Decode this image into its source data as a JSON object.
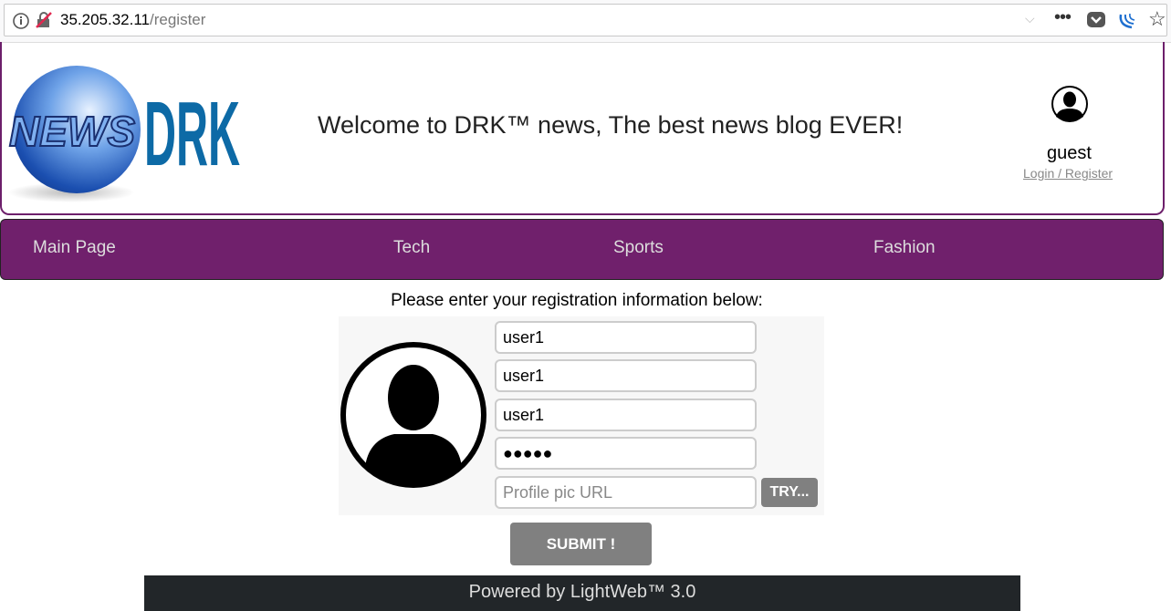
{
  "browser": {
    "url_host": "35.205.32.11",
    "url_path": "/register",
    "icons": [
      "info-icon",
      "insecure-lock-icon",
      "dropdown-icon",
      "more-icon",
      "pocket-icon",
      "jquery-icon",
      "bookmark-star-icon"
    ]
  },
  "header": {
    "logo_text": "NEWS DRK",
    "welcome": "Welcome to DRK™ news, The best news blog EVER!",
    "user_name": "guest",
    "login_link": "Login / Register"
  },
  "nav": {
    "items": [
      "Main Page",
      "Tech",
      "Sports",
      "Fashion"
    ],
    "color": "#70206c"
  },
  "form": {
    "prompt": "Please enter your registration information below:",
    "fields": [
      {
        "value": "user1"
      },
      {
        "value": "user1"
      },
      {
        "value": "user1"
      },
      {
        "value": "●●●●●",
        "type": "password"
      },
      {
        "value": "",
        "placeholder": "Profile pic URL"
      }
    ],
    "try_label": "TRY...",
    "submit_label": "SUBMIT !"
  },
  "footer": {
    "text": "Powered by LightWeb™ 3.0"
  }
}
